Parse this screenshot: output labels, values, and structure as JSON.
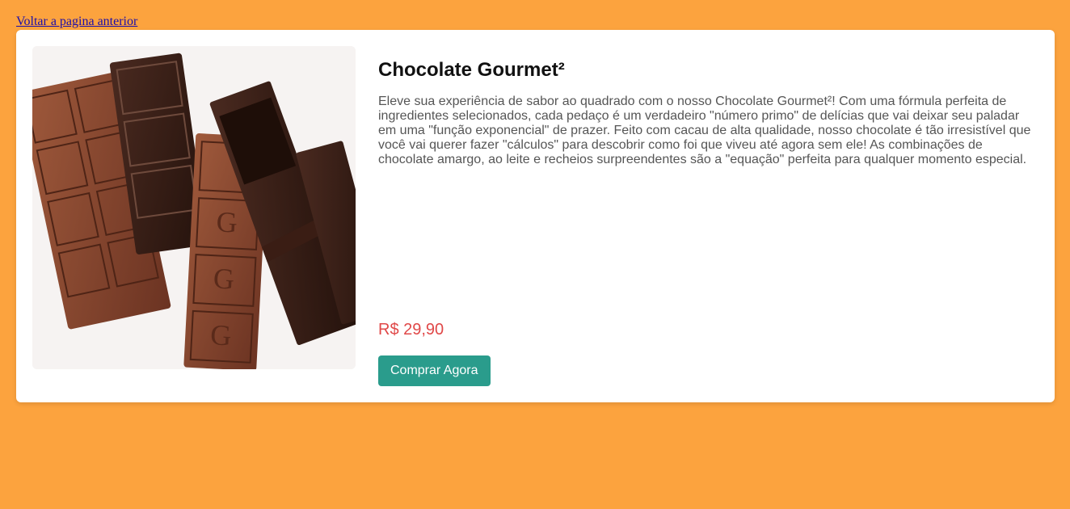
{
  "nav": {
    "back_label": "Voltar a pagina anterior"
  },
  "product": {
    "image_alt": "chocolate-bars-photo",
    "title": "Chocolate Gourmet²",
    "description": "Eleve sua experiência de sabor ao quadrado com o nosso Chocolate Gourmet²! Com uma fórmula perfeita de ingredientes selecionados, cada pedaço é um verdadeiro \"número primo\" de delícias que vai deixar seu paladar em uma \"função exponencial\" de prazer. Feito com cacau de alta qualidade, nosso chocolate é tão irresistível que você vai querer fazer \"cálculos\" para descobrir como foi que viveu até agora sem ele! As combinações de chocolate amargo, ao leite e recheios surpreendentes são a \"equação\" perfeita para qualquer momento especial.",
    "price": "R$ 29,90",
    "buy_label": "Comprar Agora"
  },
  "colors": {
    "background": "#fca33e",
    "card": "#ffffff",
    "price": "#e04848",
    "button": "#2a9c8c",
    "link": "#1a0dab"
  }
}
